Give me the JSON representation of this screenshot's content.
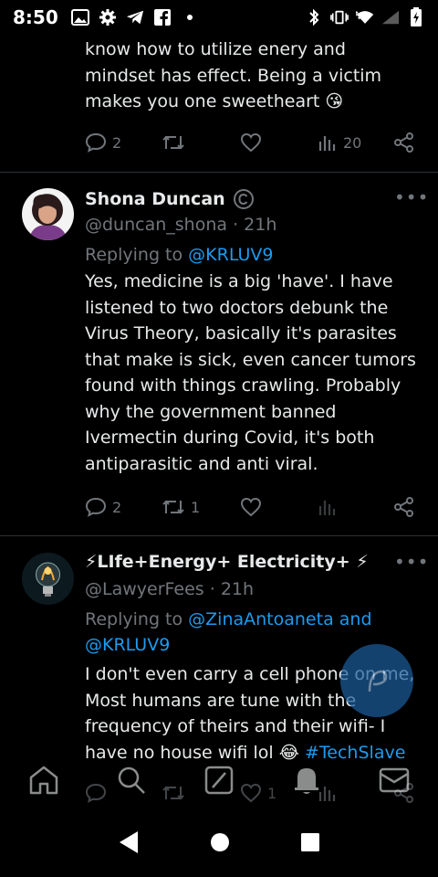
{
  "status_bar": {
    "time": "8:50",
    "left_icons": [
      "gallery-icon",
      "settings-icon",
      "telegram-icon",
      "facebook-icon",
      "dot-icon"
    ],
    "right_icons": [
      "bluetooth-icon",
      "vibrate-icon",
      "wifi-icon",
      "signal-icon",
      "battery-icon"
    ]
  },
  "tweets": [
    {
      "id": "fragment",
      "text_lines": [
        "know how to utilize enery and",
        "mindset has effect. Being a victim",
        "makes you one sweetheart 😘"
      ],
      "actions": {
        "replies": "2",
        "retweets": "",
        "likes": "",
        "views": "20"
      }
    },
    {
      "id": "shona",
      "display_name": "Shona Duncan",
      "handle": "@duncan_shona",
      "time": "21h",
      "replying_to_prefix": "Replying to ",
      "replying_to": "@KRLUV9",
      "text": "Yes, medicine is a big 'have'. I have listened to two doctors debunk the Virus Theory, basically it's parasites that make is sick, even cancer tumors found with things crawling. Probably why the government banned Ivermectin during Covid, it's both antiparasitic and anti viral.",
      "actions": {
        "replies": "2",
        "retweets": "1",
        "likes": "",
        "views": ""
      }
    },
    {
      "id": "lawyer",
      "display_name": "⚡LIfe+Energy+ Electricity+ ⚡",
      "handle": "@LawyerFees",
      "time": "21h",
      "replying_to_prefix": "Replying to ",
      "replying_to": "@ZinaAntoaneta and @KRLUV9",
      "text_main": "I don't even carry a cell phone on me, Most humans are tune with the frequency of theirs and their wifi- I have no house wifi lol 😂 ",
      "hashtag": "#TechSlave",
      "actions": {
        "replies": "",
        "retweets": "",
        "likes": "1",
        "views": ""
      }
    }
  ],
  "bottom_nav": [
    "home-icon",
    "search-icon",
    "grok-icon",
    "notifications-icon",
    "messages-icon"
  ],
  "android_nav": [
    "back-button",
    "home-button",
    "recents-button"
  ],
  "colors": {
    "accent": "#1d9bf0",
    "muted": "#71767b",
    "text": "#e7e9ea",
    "divider": "#2f3336"
  }
}
